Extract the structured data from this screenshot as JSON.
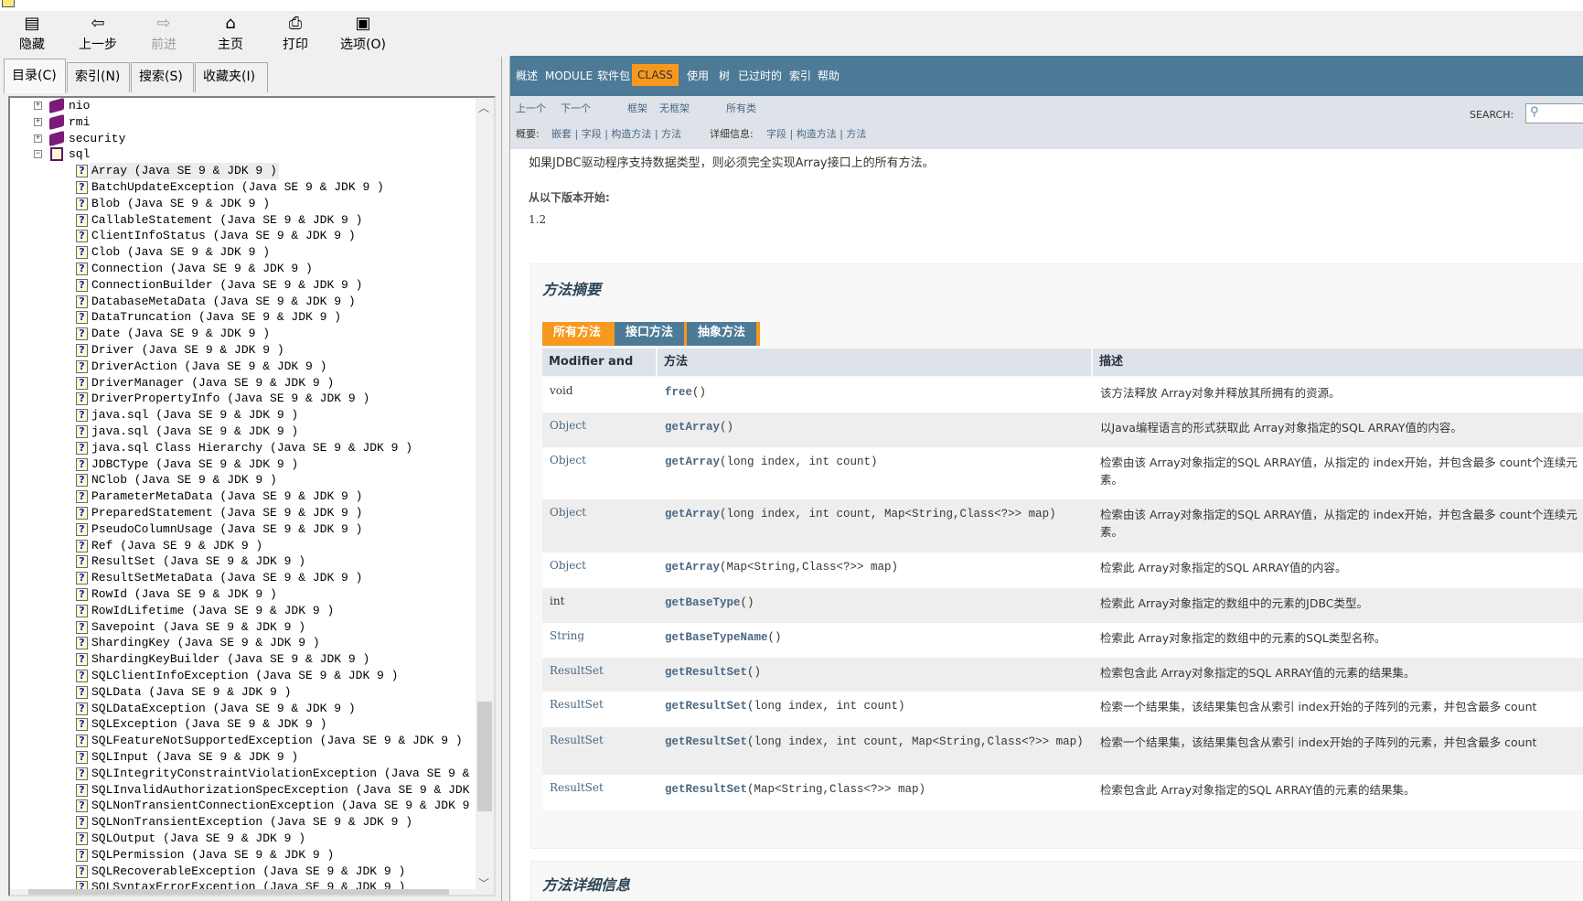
{
  "toolbar": {
    "items": [
      {
        "label": "隐藏",
        "icon": "hide-pane-icon",
        "enabled": true
      },
      {
        "label": "上一步",
        "icon": "back-arrow-icon",
        "enabled": true
      },
      {
        "label": "前进",
        "icon": "forward-arrow-icon",
        "enabled": false
      },
      {
        "label": "主页",
        "icon": "home-icon",
        "enabled": true
      },
      {
        "label": "打印",
        "icon": "print-icon",
        "enabled": true
      },
      {
        "label": "选项(O)",
        "icon": "options-icon",
        "enabled": true
      }
    ]
  },
  "left_tabs": [
    {
      "label": "目录(C)",
      "active": true
    },
    {
      "label": "索引(N)"
    },
    {
      "label": "搜索(S)"
    },
    {
      "label": "收藏夹(I)"
    }
  ],
  "tree": {
    "packages": [
      {
        "name": "nio",
        "expanded": false
      },
      {
        "name": "rmi",
        "expanded": false
      },
      {
        "name": "security",
        "expanded": false
      },
      {
        "name": "sql",
        "expanded": true
      }
    ],
    "suffix": " (Java SE 9 & JDK 9 )",
    "selected": "Array",
    "classes": [
      "Array",
      "BatchUpdateException",
      "Blob",
      "CallableStatement",
      "ClientInfoStatus",
      "Clob",
      "Connection",
      "ConnectionBuilder",
      "DatabaseMetaData",
      "DataTruncation",
      "Date",
      "Driver",
      "DriverAction",
      "DriverManager",
      "DriverPropertyInfo",
      "java.sql",
      "java.sql",
      "java.sql Class Hierarchy",
      "JDBCType",
      "NClob",
      "ParameterMetaData",
      "PreparedStatement",
      "PseudoColumnUsage",
      "Ref",
      "ResultSet",
      "ResultSetMetaData",
      "RowId",
      "RowIdLifetime",
      "Savepoint",
      "ShardingKey",
      "ShardingKeyBuilder",
      "SQLClientInfoException",
      "SQLData",
      "SQLDataException",
      "SQLException",
      "SQLFeatureNotSupportedException",
      "SQLInput",
      "SQLIntegrityConstraintViolationException",
      "SQLInvalidAuthorizationSpecException",
      "SQLNonTransientConnectionException",
      "SQLNonTransientException",
      "SQLOutput",
      "SQLPermission",
      "SQLRecoverableException",
      "SQLSyntaxErrorException"
    ]
  },
  "nav": {
    "items": [
      "概述",
      "MODULE",
      "软件包",
      "CLASS",
      "使用",
      "树",
      "已过时的",
      "索引",
      "帮助"
    ],
    "current": "CLASS",
    "accent": "#f8981d",
    "bar_color": "#4d7a97"
  },
  "subnav": {
    "prev": "上一个",
    "next": "下一个",
    "frames": "框架",
    "noframes": "无框架",
    "all_classes": "所有类",
    "summary_label": "概要:",
    "summary_links": "嵌套 | 字段 | 构造方法 | 方法",
    "detail_label": "详细信息:",
    "detail_links": "字段 | 构造方法 | 方法",
    "search_label": "SEARCH:"
  },
  "content": {
    "description": "如果JDBC驱动程序支持数据类型，则必须完全实现Array接口上的所有方法。",
    "since_label": "从以下版本开始:",
    "since_value": "1.2",
    "summary_title": "方法摘要",
    "method_tabs": [
      {
        "label": "所有方法",
        "active": true
      },
      {
        "label": "接口方法"
      },
      {
        "label": "抽象方法"
      }
    ],
    "columns": [
      "Modifier and Type",
      "方法",
      "描述"
    ],
    "methods": [
      {
        "type": "void",
        "link": false,
        "name": "free",
        "params": "()",
        "desc": "该方法释放 Array对象并释放其所拥有的资源。"
      },
      {
        "type": "Object",
        "link": true,
        "name": "getArray",
        "params": "()",
        "desc": "以Java编程语言的形式获取此 Array对象指定的SQL ARRAY值的内容。"
      },
      {
        "type": "Object",
        "link": true,
        "name": "getArray",
        "params": "(long index, int count)",
        "desc": "检索由该 Array对象指定的SQL ARRAY值，从指定的 index开始，并包含最多 count个连续元素。"
      },
      {
        "type": "Object",
        "link": true,
        "name": "getArray",
        "params": "(long index, int count, Map<String,Class<?>> map)",
        "desc": "检索由该 Array对象指定的SQL ARRAY值，从指定的 index开始，并包含最多 count个连续元素。"
      },
      {
        "type": "Object",
        "link": true,
        "name": "getArray",
        "params": "(Map<String,Class<?>> map)",
        "desc": "检索此 Array对象指定的SQL ARRAY值的内容。"
      },
      {
        "type": "int",
        "link": false,
        "name": "getBaseType",
        "params": "()",
        "desc": "检索此 Array对象指定的数组中的元素的JDBC类型。"
      },
      {
        "type": "String",
        "link": true,
        "name": "getBaseTypeName",
        "params": "()",
        "desc": "检索此 Array对象指定的数组中的元素的SQL类型名称。"
      },
      {
        "type": "ResultSet",
        "link": true,
        "name": "getResultSet",
        "params": "()",
        "desc": "检索包含此 Array对象指定的SQL ARRAY值的元素的结果集。"
      },
      {
        "type": "ResultSet",
        "link": true,
        "name": "getResultSet",
        "params": "(long index, int count)",
        "desc": "检索一个结果集，该结果集包含从索引 index开始的子阵列的元素，并包含最多 count"
      },
      {
        "type": "ResultSet",
        "link": true,
        "name": "getResultSet",
        "params": "(long index, int count, Map<String,Class<?>> map)",
        "desc": "检索一个结果集，该结果集包含从索引 index开始的子阵列的元素，并包含最多 count"
      },
      {
        "type": "ResultSet",
        "link": true,
        "name": "getResultSet",
        "params": "(Map<String,Class<?>> map)",
        "desc": "检索包含此 Array对象指定的SQL ARRAY值的元素的结果集。"
      }
    ],
    "detail_title": "方法详细信息"
  }
}
